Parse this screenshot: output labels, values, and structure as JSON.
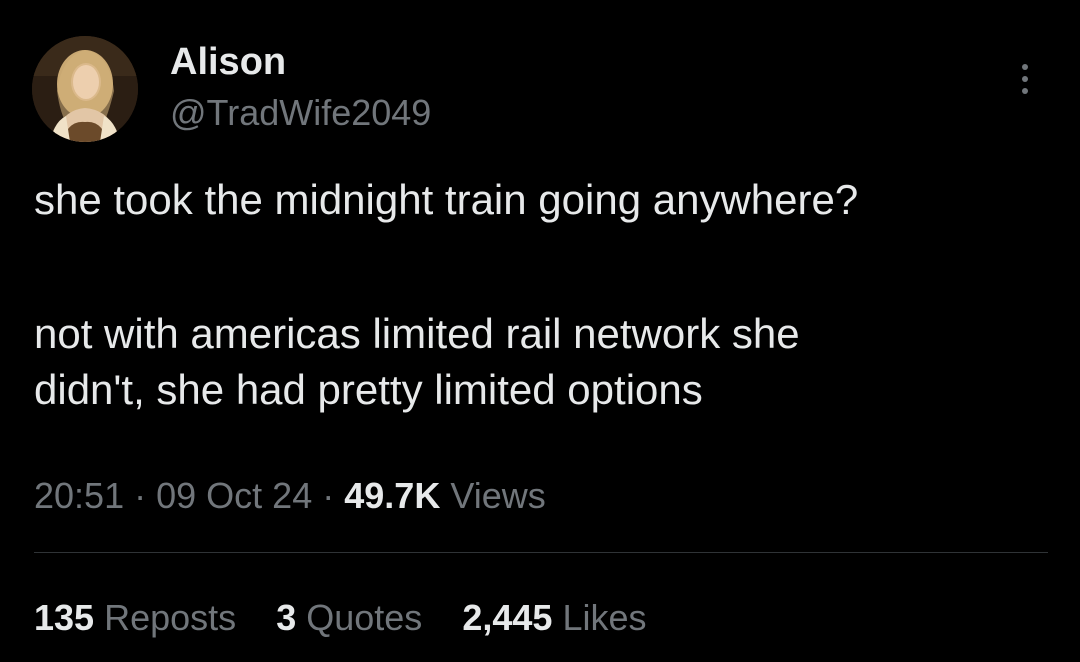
{
  "author": {
    "display_name": "Alison",
    "handle": "@TradWife2049",
    "avatar_icon": "profile-photo"
  },
  "tweet": {
    "paragraphs": [
      [
        "she took the midnight train going anywhere?"
      ],
      [
        "not with americas limited rail network she",
        "didn't, she had pretty limited options"
      ]
    ]
  },
  "meta": {
    "time": "20:51",
    "separator": "·",
    "date": "09 Oct 24",
    "views_count": "49.7K",
    "views_label": "Views"
  },
  "stats": {
    "reposts_count": "135",
    "reposts_label": "Reposts",
    "quotes_count": "3",
    "quotes_label": "Quotes",
    "likes_count": "2,445",
    "likes_label": "Likes"
  },
  "colors": {
    "background": "#000000",
    "primary_text": "#e7e9ea",
    "secondary_text": "#71767b",
    "divider": "#2f3336"
  },
  "more_icon": "more-vertical-icon"
}
